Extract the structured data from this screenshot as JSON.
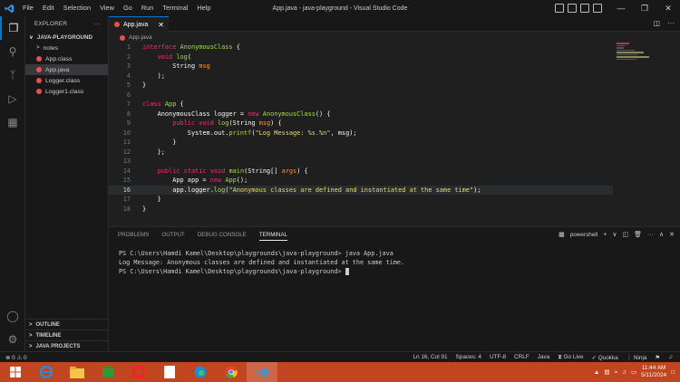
{
  "window": {
    "title": "App.java - java-playground - Visual Studio Code",
    "menu": [
      "File",
      "Edit",
      "Selection",
      "View",
      "Go",
      "Run",
      "Terminal",
      "Help"
    ]
  },
  "sidebar": {
    "header": "EXPLORER",
    "project": "JAVA-PLAYGROUND",
    "items": [
      {
        "label": "notes",
        "type": "folder"
      },
      {
        "label": "App.class",
        "type": "java"
      },
      {
        "label": "App.java",
        "type": "java"
      },
      {
        "label": "Logger.class",
        "type": "java"
      },
      {
        "label": "Logger1.class",
        "type": "java"
      }
    ],
    "sections": [
      "OUTLINE",
      "TIMELINE",
      "JAVA PROJECTS"
    ]
  },
  "editor": {
    "tab_label": "App.java",
    "breadcrumb": "App.java",
    "current_line": 16,
    "line_numbers": [
      "1",
      "2",
      "3",
      "4",
      "5",
      "6",
      "7",
      "8",
      "9",
      "10",
      "11",
      "12",
      "13",
      "14",
      "15",
      "16",
      "17",
      "18"
    ]
  },
  "panel": {
    "tabs": [
      "PROBLEMS",
      "OUTPUT",
      "DEBUG CONSOLE",
      "TERMINAL"
    ],
    "active_tab": "TERMINAL",
    "shell": "powershell",
    "lines": [
      "PS C:\\Users\\Hamdi Kamel\\Desktop\\playgrounds\\java-playground> java App.java",
      "Log Message: Anonymous classes are defined and instantiated at the same time.",
      "PS C:\\Users\\Hamdi Kamel\\Desktop\\playgrounds\\java-playground> "
    ]
  },
  "status": {
    "problems": "⊗ 0 ⚠ 0",
    "position": "Ln 16, Col 91",
    "spaces": "Spaces: 4",
    "encoding": "UTF-8",
    "eol": "CRLF",
    "language": "Java",
    "golive": "Go Live",
    "quokka": "Quokka",
    "ninja": "Ninja"
  },
  "taskbar": {
    "time": "11:44 AM",
    "date": "5/11/2024",
    "accent": "#c1451f"
  },
  "colors": {
    "keyword": "#f92672",
    "type": "#a6e22e",
    "string": "#e6db74",
    "accent": "#0078d4"
  }
}
